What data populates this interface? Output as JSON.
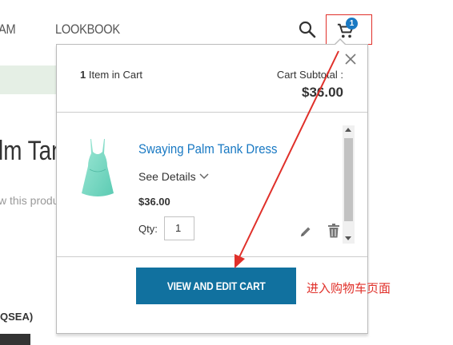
{
  "header": {
    "nav_items": [
      "AM",
      "LOOKBOOK"
    ],
    "search_icon": "search-icon",
    "cart_icon": "cart-icon",
    "cart_count": "1"
  },
  "background_page": {
    "product_title_fragment": "lm Tan",
    "review_fragment": "w this produ",
    "sku_fragment": "QSEA)"
  },
  "minicart": {
    "items_count_number": "1",
    "items_count_text": "Item in Cart",
    "subtotal_label": "Cart Subtotal :",
    "subtotal_value": "$36.00",
    "item": {
      "name": "Swaying Palm Tank Dress",
      "see_details_label": "See Details",
      "price": "$36.00",
      "qty_label": "Qty:",
      "qty_value": "1"
    },
    "view_cart_label": "VIEW AND EDIT CART"
  },
  "annotation": {
    "text": "进入购物车页面",
    "color": "#e0302a"
  },
  "colors": {
    "accent": "#1979c3",
    "button_bg": "#11719f"
  }
}
